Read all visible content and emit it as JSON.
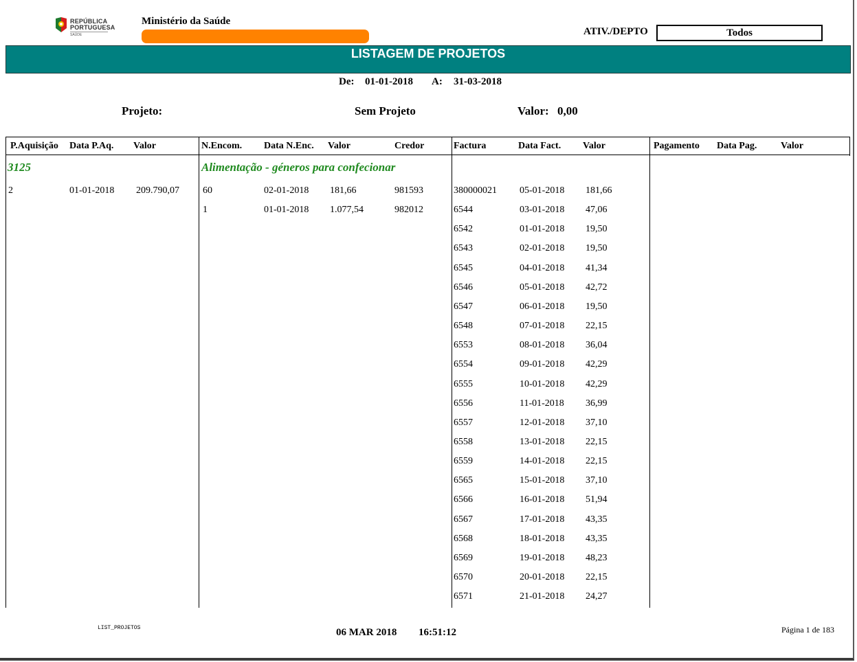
{
  "header": {
    "logo": {
      "line1": "REPÚBLICA",
      "line2": "PORTUGUESA",
      "line3": "SAÚDE"
    },
    "ministry": "Ministério da Saúde",
    "ativ_label": "ATIV./DEPTO",
    "ativ_value": "Todos",
    "redaction_color": "#ff8200"
  },
  "banner": {
    "title": "LISTAGEM DE PROJETOS",
    "color": "#008080"
  },
  "period": {
    "from_label": "De:",
    "from": "01-01-2018",
    "to_label": "A:",
    "to": "31-03-2018"
  },
  "project": {
    "label": "Projeto:",
    "name": "Sem Projeto",
    "valor_label": "Valor:",
    "valor": "0,00"
  },
  "columns": {
    "paq": "P.Aquisição",
    "data_paq": "Data P.Aq.",
    "valor1": "Valor",
    "nenc": "N.Encom.",
    "data_nenc": "Data N.Enc.",
    "valor2": "Valor",
    "credor": "Credor",
    "factura": "Factura",
    "data_fact": "Data Fact.",
    "valor3": "Valor",
    "pagamento": "Pagamento",
    "data_pag": "Data Pag.",
    "valor4": "Valor"
  },
  "group": {
    "code": "3125",
    "description": "Alimentação - géneros para confecionar",
    "color": "#1f8a1f"
  },
  "acquisitions": [
    {
      "num": "2",
      "data": "01-01-2018",
      "valor": "209.790,07"
    }
  ],
  "orders": [
    {
      "num": "60",
      "data": "02-01-2018",
      "valor": "181,66",
      "credor": "981593"
    },
    {
      "num": "1",
      "data": "01-01-2018",
      "valor": "1.077,54",
      "credor": "982012"
    }
  ],
  "invoices": [
    {
      "num": "380000021",
      "data": "05-01-2018",
      "valor": "181,66"
    },
    {
      "num": "6544",
      "data": "03-01-2018",
      "valor": "47,06"
    },
    {
      "num": "6542",
      "data": "01-01-2018",
      "valor": "19,50"
    },
    {
      "num": "6543",
      "data": "02-01-2018",
      "valor": "19,50"
    },
    {
      "num": "6545",
      "data": "04-01-2018",
      "valor": "41,34"
    },
    {
      "num": "6546",
      "data": "05-01-2018",
      "valor": "42,72"
    },
    {
      "num": "6547",
      "data": "06-01-2018",
      "valor": "19,50"
    },
    {
      "num": "6548",
      "data": "07-01-2018",
      "valor": "22,15"
    },
    {
      "num": "6553",
      "data": "08-01-2018",
      "valor": "36,04"
    },
    {
      "num": "6554",
      "data": "09-01-2018",
      "valor": "42,29"
    },
    {
      "num": "6555",
      "data": "10-01-2018",
      "valor": "42,29"
    },
    {
      "num": "6556",
      "data": "11-01-2018",
      "valor": "36,99"
    },
    {
      "num": "6557",
      "data": "12-01-2018",
      "valor": "37,10"
    },
    {
      "num": "6558",
      "data": "13-01-2018",
      "valor": "22,15"
    },
    {
      "num": "6559",
      "data": "14-01-2018",
      "valor": "22,15"
    },
    {
      "num": "6565",
      "data": "15-01-2018",
      "valor": "37,10"
    },
    {
      "num": "6566",
      "data": "16-01-2018",
      "valor": "51,94"
    },
    {
      "num": "6567",
      "data": "17-01-2018",
      "valor": "43,35"
    },
    {
      "num": "6568",
      "data": "18-01-2018",
      "valor": "43,35"
    },
    {
      "num": "6569",
      "data": "19-01-2018",
      "valor": "48,23"
    },
    {
      "num": "6570",
      "data": "20-01-2018",
      "valor": "22,15"
    },
    {
      "num": "6571",
      "data": "21-01-2018",
      "valor": "24,27"
    }
  ],
  "footer": {
    "report_code": "LIST_PROJETOS",
    "date": "06 MAR 2018",
    "time": "16:51:12",
    "page": "Página 1 de 183"
  }
}
